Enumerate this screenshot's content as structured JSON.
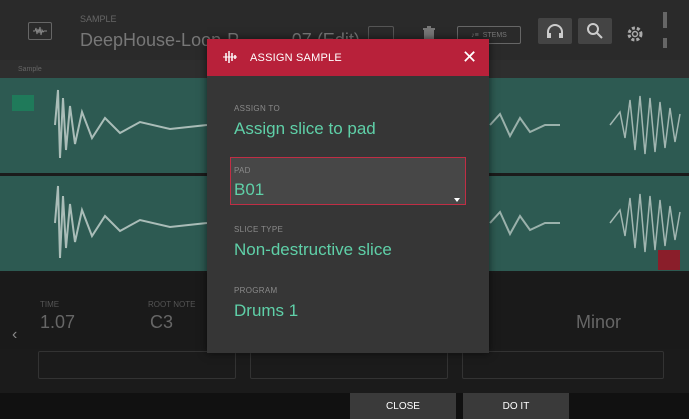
{
  "header": {
    "file_tag": "SAMPLE",
    "file_name": "DeepHouse-Loop-P...........07 (Edit)",
    "stems_label": "STEMS"
  },
  "ruler": {
    "sample_label": "Sample"
  },
  "params": {
    "left_label": "TIME",
    "left_value": "1.07",
    "mid_label": "ROOT NOTE",
    "mid_value": "C3",
    "right_value": "Minor"
  },
  "dialog": {
    "title": "ASSIGN SAMPLE",
    "close_glyph": "✕",
    "assign_to_label": "ASSIGN TO",
    "assign_to_value": "Assign slice to pad",
    "pad_label": "PAD",
    "pad_value": "B01",
    "slice_type_label": "SLICE TYPE",
    "slice_type_value": "Non-destructive slice",
    "program_label": "PROGRAM",
    "program_value": "Drums 1"
  },
  "footer": {
    "close_label": "CLOSE",
    "doit_label": "DO IT"
  },
  "icons": {
    "waveform": "waveform-icon",
    "trash": "trash-icon",
    "headphones": "headphones-icon",
    "zoom": "zoom-icon",
    "gear": "gear-icon",
    "sample_assign": "sample-assign-icon",
    "dropdown": "dropdown-arrow-icon",
    "chevron_left": "chevron-left-icon"
  },
  "colors": {
    "accent_red": "#b8213a",
    "accent_teal": "#5fd0a8",
    "waveform_track": "#2d5a52"
  }
}
